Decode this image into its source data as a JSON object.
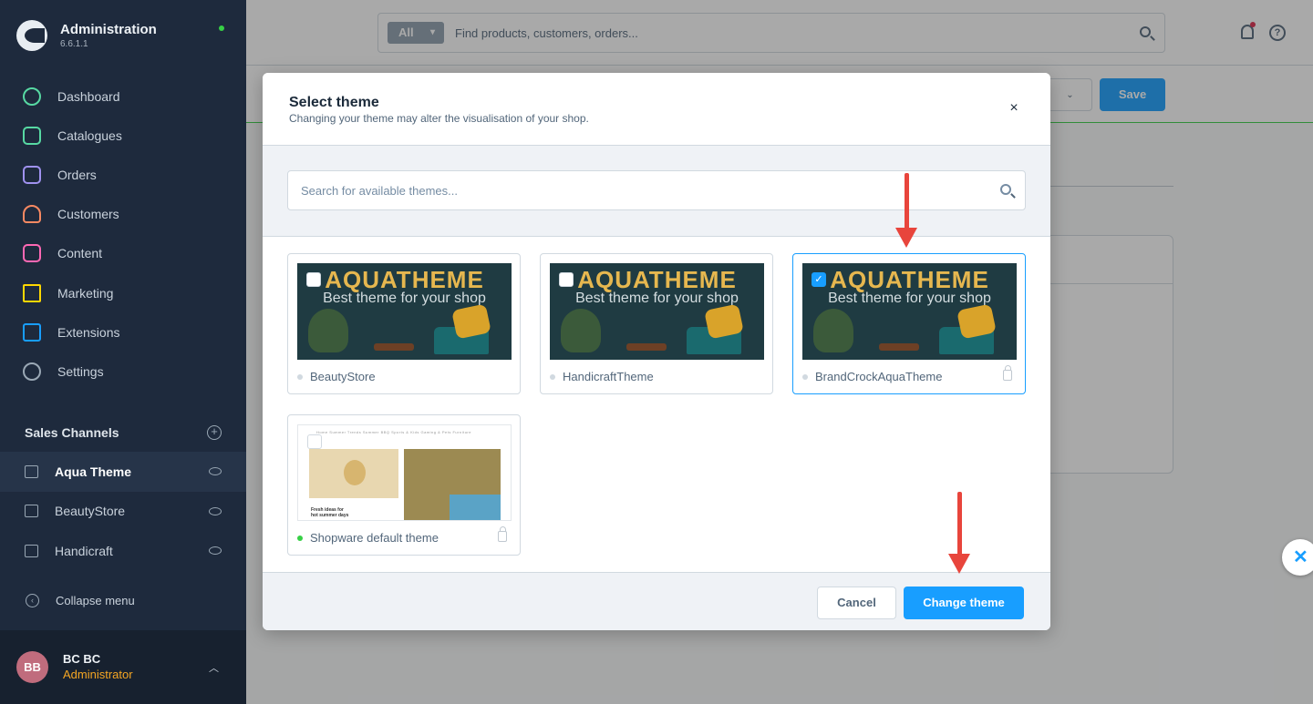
{
  "app": {
    "title": "Administration",
    "version": "6.6.1.1"
  },
  "sidebar": {
    "items": [
      {
        "label": "Dashboard",
        "icon": "dashboard-icon"
      },
      {
        "label": "Catalogues",
        "icon": "catalogues-icon"
      },
      {
        "label": "Orders",
        "icon": "orders-icon"
      },
      {
        "label": "Customers",
        "icon": "customers-icon"
      },
      {
        "label": "Content",
        "icon": "content-icon"
      },
      {
        "label": "Marketing",
        "icon": "marketing-icon"
      },
      {
        "label": "Extensions",
        "icon": "extensions-icon"
      },
      {
        "label": "Settings",
        "icon": "settings-icon"
      }
    ],
    "sales_channels_title": "Sales Channels",
    "sales_channels": [
      {
        "label": "Aqua Theme",
        "active": true
      },
      {
        "label": "BeautyStore",
        "active": false
      },
      {
        "label": "Handicraft",
        "active": false
      }
    ],
    "collapse_label": "Collapse menu",
    "user": {
      "initials": "BB",
      "name": "BC BC",
      "role": "Administrator"
    }
  },
  "topbar": {
    "search_type": "All",
    "search_placeholder": "Find products, customers, orders...",
    "help_label": "?"
  },
  "page": {
    "save_label": "Save"
  },
  "modal": {
    "title": "Select theme",
    "subtitle": "Changing your theme may alter the visualisation of your shop.",
    "close_label": "×",
    "search_placeholder": "Search for available themes...",
    "themes": [
      {
        "name": "BeautyStore",
        "banner_title": "AQUATHEME",
        "banner_subtitle": "Best theme for your shop",
        "selected": false,
        "active": false,
        "locked": false
      },
      {
        "name": "HandicraftTheme",
        "banner_title": "AQUATHEME",
        "banner_subtitle": "Best theme for your shop",
        "selected": false,
        "active": false,
        "locked": false
      },
      {
        "name": "BrandCrockAquaTheme",
        "banner_title": "AQUATHEME",
        "banner_subtitle": "Best theme for your shop",
        "selected": true,
        "active": false,
        "locked": true
      },
      {
        "name": "Shopware default theme",
        "preview_nav": "Home   Summer Trends   Summer BBQ   Sports & Kids   Gaming & Pets   Furniture",
        "preview_text": "Fresh ideas for\nhot summer days",
        "selected": false,
        "active": true,
        "locked": true
      }
    ],
    "cancel_label": "Cancel",
    "change_label": "Change theme"
  },
  "colors": {
    "sidebar_bg": "#1e2a3d",
    "accent": "#189eff",
    "annotation_arrow": "#e8453c",
    "active_dot": "#37d046"
  }
}
